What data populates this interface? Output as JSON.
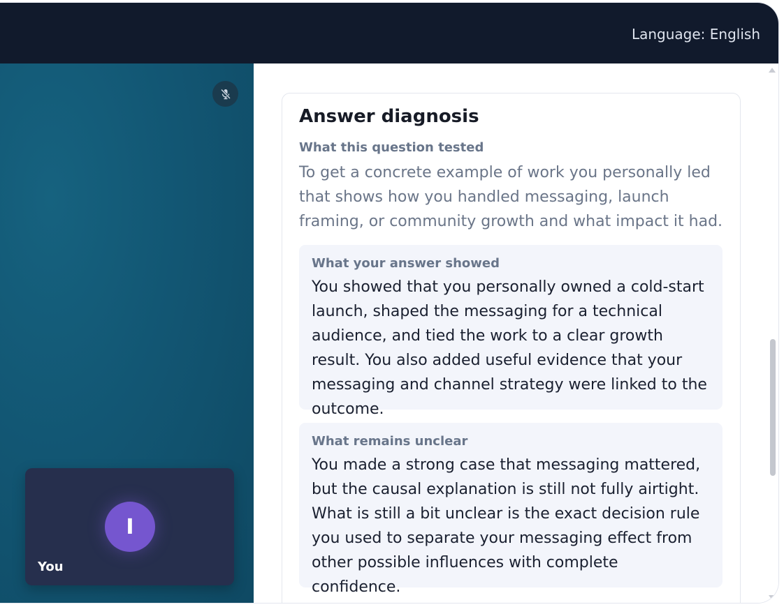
{
  "header": {
    "language_label": "Language: English"
  },
  "video": {
    "mic_icon": "mic-off-icon",
    "self": {
      "avatar_initial": "I",
      "name": "You"
    }
  },
  "diagnosis": {
    "title": "Answer diagnosis",
    "question_label": "What this question tested",
    "question_text": "To get a concrete example of work you personally led that shows how you handled messaging, launch framing, or community growth and what impact it had.",
    "showed_label": "What your answer showed",
    "showed_text": "You showed that you personally owned a cold-start launch, shaped the messaging for a technical audience, and tied the work to a clear growth result. You also added useful evidence that your messaging and channel strategy were linked to the outcome.",
    "unclear_label": "What remains unclear",
    "unclear_text": "You made a strong case that messaging mattered, but the causal explanation is still not fully airtight. What is still a bit unclear is the exact decision rule you used to separate your messaging effect from other possible influences with complete confidence."
  },
  "colors": {
    "header_bg": "#111a2c",
    "video_bg": "#125673",
    "avatar_bg": "#7556cf",
    "box_bg": "#f3f5fb"
  }
}
